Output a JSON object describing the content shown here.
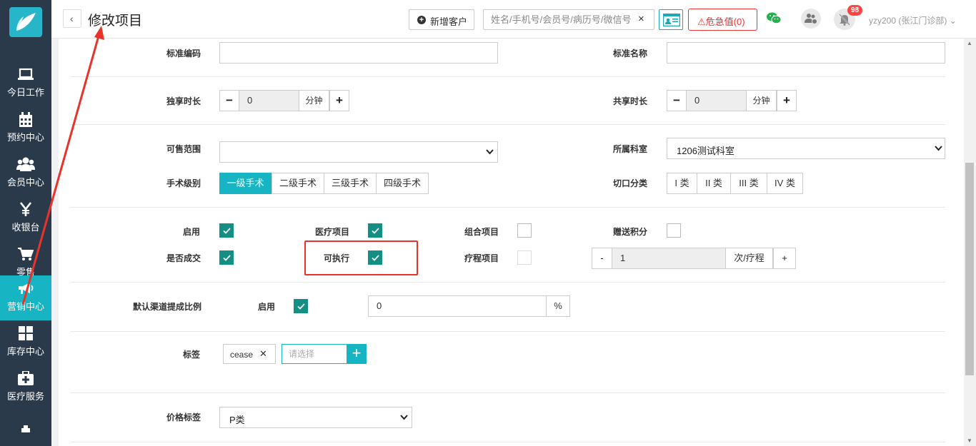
{
  "sidebar": {
    "items": [
      {
        "label": "今日工作"
      },
      {
        "label": "预约中心"
      },
      {
        "label": "会员中心"
      },
      {
        "label": "收银台"
      },
      {
        "label": "零售"
      },
      {
        "label": "营销中心"
      },
      {
        "label": "库存中心"
      },
      {
        "label": "医疗服务"
      }
    ],
    "active": "营销中心"
  },
  "header": {
    "title": "修改项目",
    "add_customer": "新增客户",
    "search_placeholder": "姓名/手机号/会员号/病历号/微信号",
    "clear_icon": "×",
    "critical_label": "危急值",
    "critical_count": "0",
    "notification_count": "98",
    "user": "yzy200 (张江门诊部)"
  },
  "form": {
    "standard_code": {
      "label": "标准编码",
      "value": ""
    },
    "standard_name": {
      "label": "标准名称",
      "value": ""
    },
    "exclusive_duration": {
      "label": "独享时长",
      "value": "0",
      "unit": "分钟"
    },
    "shared_duration": {
      "label": "共享时长",
      "value": "0",
      "unit": "分钟"
    },
    "sale_scope": {
      "label": "可售范围",
      "value": ""
    },
    "department": {
      "label": "所属科室",
      "value": "1206测试科室"
    },
    "surgery_level": {
      "label": "手术级别",
      "options": [
        "一级手术",
        "二级手术",
        "三级手术",
        "四级手术"
      ],
      "selected": "一级手术"
    },
    "incision_class": {
      "label": "切口分类",
      "options": [
        "I 类",
        "II 类",
        "III 类",
        "IV 类"
      ]
    },
    "enabled": {
      "label": "启用",
      "checked": true
    },
    "medical_item": {
      "label": "医疗项目",
      "checked": true
    },
    "combo_item": {
      "label": "组合项目",
      "checked": false
    },
    "bonus_points": {
      "label": "赠送积分",
      "checked": false
    },
    "deal_closed": {
      "label": "是否成交",
      "checked": true
    },
    "executable": {
      "label": "可执行",
      "checked": true
    },
    "course_item": {
      "label": "疗程项目",
      "checked": false
    },
    "course_count": {
      "minus": "-",
      "value": "1",
      "unit": "次/疗程",
      "plus": "+"
    },
    "channel_commission": {
      "label": "默认渠道提成比例",
      "enable_label": "启用",
      "checked": true,
      "value": "0",
      "unit": "%"
    },
    "tags": {
      "label": "标签",
      "items": [
        "cease"
      ],
      "placeholder": "请选择",
      "add": "+"
    },
    "price_tag": {
      "label": "价格标签",
      "value": "P类"
    }
  },
  "colors": {
    "sidebar_bg": "#2b3a4b",
    "accent": "#17b5c4",
    "checkbox_on": "#138f84",
    "danger": "#e33",
    "annotation": "#e8332b"
  }
}
